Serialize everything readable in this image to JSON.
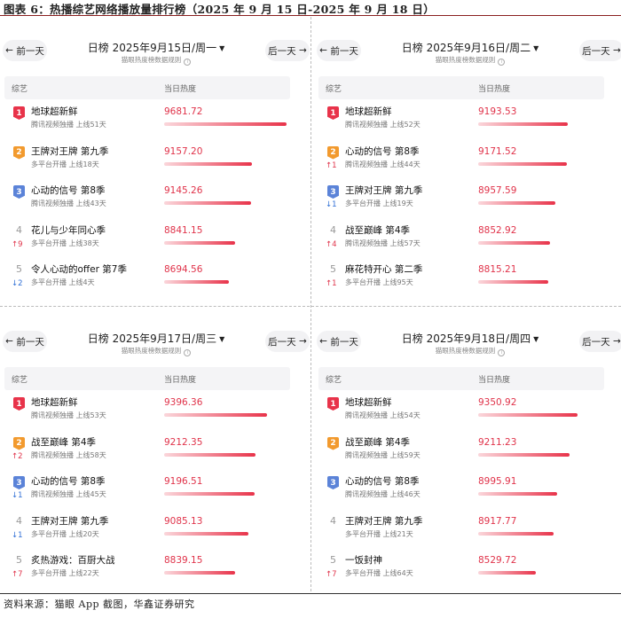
{
  "figure_title": "图表 6：热播综艺网络播放量排行榜（2025 年 9 月 15 日-2025 年 9 月 18 日）",
  "footer": "资料来源：猫眼 App 截图，华鑫证券研究",
  "common": {
    "prev_label": "前一天",
    "next_label": "后一天",
    "rule_text": "猫眼热度榜数据规则",
    "col_name": "综艺",
    "col_heat": "当日热度",
    "date_prefix": "日榜",
    "badge_colors": [
      "#e8334a",
      "#f29a2e",
      "#5b83d8"
    ]
  },
  "panels": [
    {
      "date": "2025年9月15日/周一",
      "rows": [
        {
          "rank": "1",
          "name": "地球超新鲜",
          "sub": "腾讯视频独播 上线51天",
          "heat": 9681.72,
          "heat_text": "9681.72",
          "delta": ""
        },
        {
          "rank": "2",
          "name": "王牌对王牌 第九季",
          "sub": "多平台开播 上线18天",
          "heat": 9157.2,
          "heat_text": "9157.20",
          "delta": ""
        },
        {
          "rank": "3",
          "name": "心动的信号 第8季",
          "sub": "腾讯视频独播 上线43天",
          "heat": 9145.26,
          "heat_text": "9145.26",
          "delta": ""
        },
        {
          "rank": "4",
          "name": "花儿与少年同心季",
          "sub": "多平台开播 上线38天",
          "heat": 8841.15,
          "heat_text": "8841.15",
          "delta": "↑9"
        },
        {
          "rank": "5",
          "name": "令人心动的offer 第7季",
          "sub": "多平台开播 上线4天",
          "heat": 8694.56,
          "heat_text": "8694.56",
          "delta": "↓2"
        }
      ]
    },
    {
      "date": "2025年9月16日/周二",
      "rows": [
        {
          "rank": "1",
          "name": "地球超新鲜",
          "sub": "腾讯视频独播 上线52天",
          "heat": 9193.53,
          "heat_text": "9193.53",
          "delta": ""
        },
        {
          "rank": "2",
          "name": "心动的信号 第8季",
          "sub": "腾讯视频独播 上线44天",
          "heat": 9171.52,
          "heat_text": "9171.52",
          "delta": "↑1"
        },
        {
          "rank": "3",
          "name": "王牌对王牌 第九季",
          "sub": "多平台开播 上线19天",
          "heat": 8957.59,
          "heat_text": "8957.59",
          "delta": "↓1"
        },
        {
          "rank": "4",
          "name": "战至巅峰 第4季",
          "sub": "腾讯视频独播 上线57天",
          "heat": 8852.92,
          "heat_text": "8852.92",
          "delta": "↑4"
        },
        {
          "rank": "5",
          "name": "麻花特开心 第二季",
          "sub": "多平台开播 上线95天",
          "heat": 8815.21,
          "heat_text": "8815.21",
          "delta": "↑1"
        }
      ]
    },
    {
      "date": "2025年9月17日/周三",
      "rows": [
        {
          "rank": "1",
          "name": "地球超新鲜",
          "sub": "腾讯视频独播 上线53天",
          "heat": 9396.36,
          "heat_text": "9396.36",
          "delta": ""
        },
        {
          "rank": "2",
          "name": "战至巅峰 第4季",
          "sub": "腾讯视频独播 上线58天",
          "heat": 9212.35,
          "heat_text": "9212.35",
          "delta": "↑2"
        },
        {
          "rank": "3",
          "name": "心动的信号 第8季",
          "sub": "腾讯视频独播 上线45天",
          "heat": 9196.51,
          "heat_text": "9196.51",
          "delta": "↓1"
        },
        {
          "rank": "4",
          "name": "王牌对王牌 第九季",
          "sub": "多平台开播 上线20天",
          "heat": 9085.13,
          "heat_text": "9085.13",
          "delta": "↓1"
        },
        {
          "rank": "5",
          "name": "炙热游戏：百厨大战",
          "sub": "多平台开播 上线22天",
          "heat": 8839.15,
          "heat_text": "8839.15",
          "delta": "↑7"
        }
      ]
    },
    {
      "date": "2025年9月18日/周四",
      "rows": [
        {
          "rank": "1",
          "name": "地球超新鲜",
          "sub": "腾讯视频独播 上线54天",
          "heat": 9350.92,
          "heat_text": "9350.92",
          "delta": ""
        },
        {
          "rank": "2",
          "name": "战至巅峰 第4季",
          "sub": "腾讯视频独播 上线59天",
          "heat": 9211.23,
          "heat_text": "9211.23",
          "delta": ""
        },
        {
          "rank": "3",
          "name": "心动的信号 第8季",
          "sub": "腾讯视频独播 上线46天",
          "heat": 8995.91,
          "heat_text": "8995.91",
          "delta": ""
        },
        {
          "rank": "4",
          "name": "王牌对王牌 第九季",
          "sub": "多平台开播 上线21天",
          "heat": 8917.77,
          "heat_text": "8917.77",
          "delta": ""
        },
        {
          "rank": "5",
          "name": "一饭封神",
          "sub": "多平台开播 上线64天",
          "heat": 8529.72,
          "heat_text": "8529.72",
          "delta": "↑7"
        }
      ]
    }
  ]
}
